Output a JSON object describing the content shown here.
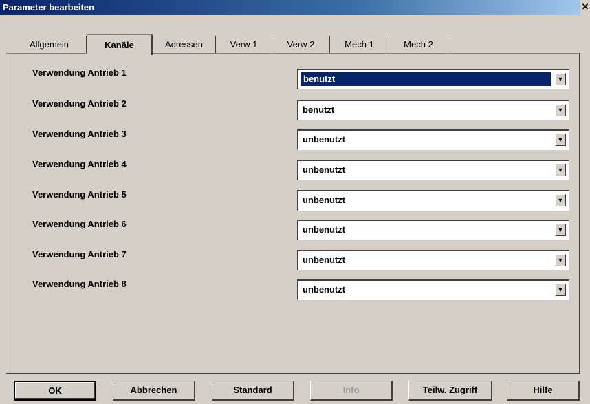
{
  "window": {
    "title": "Parameter bearbeiten",
    "close_glyph": "✕"
  },
  "tabs": [
    {
      "label": "Allgemein",
      "active": false
    },
    {
      "label": "Kanäle",
      "active": true
    },
    {
      "label": "Adressen",
      "active": false
    },
    {
      "label": "Verw 1",
      "active": false
    },
    {
      "label": "Verw 2",
      "active": false
    },
    {
      "label": "Mech 1",
      "active": false
    },
    {
      "label": "Mech 2",
      "active": false
    }
  ],
  "rows": [
    {
      "label": "Verwendung Antrieb 1",
      "value": "benutzt",
      "selected": true
    },
    {
      "label": "Verwendung Antrieb 2",
      "value": "benutzt",
      "selected": false
    },
    {
      "label": "Verwendung Antrieb 3",
      "value": "unbenutzt",
      "selected": false
    },
    {
      "label": "Verwendung Antrieb 4",
      "value": "unbenutzt",
      "selected": false
    },
    {
      "label": "Verwendung Antrieb 5",
      "value": "unbenutzt",
      "selected": false
    },
    {
      "label": "Verwendung Antrieb 6",
      "value": "unbenutzt",
      "selected": false
    },
    {
      "label": "Verwendung Antrieb 7",
      "value": "unbenutzt",
      "selected": false
    },
    {
      "label": "Verwendung Antrieb 8",
      "value": "unbenutzt",
      "selected": false
    }
  ],
  "dropdown_arrow_glyph": "▼",
  "buttons": {
    "ok": "OK",
    "cancel": "Abbrechen",
    "standard": "Standard",
    "info": "Info",
    "partial_access": "Teilw. Zugriff",
    "help": "Hilfe"
  },
  "colors": {
    "selection": "#0a246a",
    "face": "#d4d0c8"
  }
}
